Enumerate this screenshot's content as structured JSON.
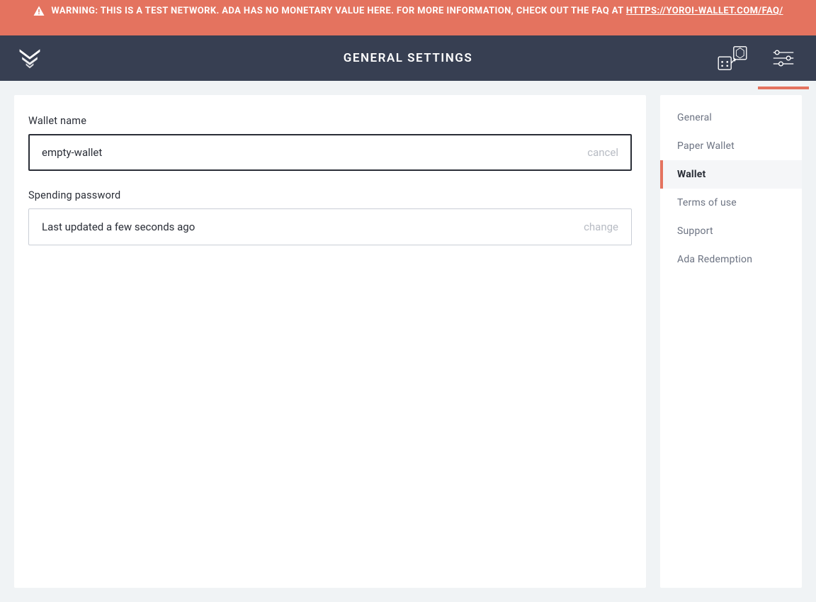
{
  "warning": {
    "prefix": "WARNING: THIS IS A TEST NETWORK. ADA HAS NO MONETARY VALUE HERE. FOR MORE INFORMATION, CHECK OUT THE FAQ AT ",
    "link_text": "HTTPS://YOROI-WALLET.COM/FAQ/"
  },
  "header": {
    "title": "GENERAL SETTINGS"
  },
  "main": {
    "wallet_name": {
      "label": "Wallet name",
      "value": "empty-wallet",
      "action": "cancel"
    },
    "spending_password": {
      "label": "Spending password",
      "value": "Last updated a few seconds ago",
      "action": "change"
    }
  },
  "sidebar": {
    "items": [
      {
        "label": "General"
      },
      {
        "label": "Paper Wallet"
      },
      {
        "label": "Wallet"
      },
      {
        "label": "Terms of use"
      },
      {
        "label": "Support"
      },
      {
        "label": "Ada Redemption"
      }
    ],
    "active_index": 2
  },
  "colors": {
    "accent": "#e4735f",
    "header_bg": "#373f52",
    "page_bg": "#f0f3f5"
  }
}
